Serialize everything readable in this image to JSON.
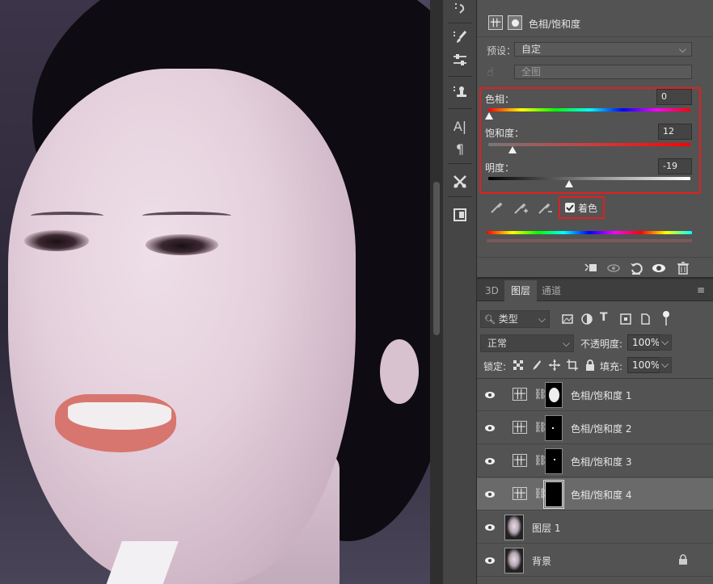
{
  "properties": {
    "title": "色相/饱和度",
    "preset_label": "预设：",
    "preset_value": "自定",
    "channel_value": "全图",
    "hue_label": "色相：",
    "hue_value": "0",
    "saturation_label": "饱和度：",
    "saturation_value": "12",
    "lightness_label": "明度：",
    "lightness_value": "-19",
    "colorize_label": "着色",
    "colorize_checked": true,
    "icons": [
      "adjust-layer-icon",
      "mask-icon",
      "hand-target-icon",
      "eyedropper-icon",
      "eyedropper-plus-icon",
      "eyedropper-minus-icon",
      "clip-layer-icon",
      "view-previous-icon",
      "reset-icon",
      "visibility-icon",
      "trash-icon"
    ]
  },
  "layers_panel": {
    "tabs": [
      "3D",
      "图层",
      "通道"
    ],
    "active_tab": "图层",
    "filter_label": "类型",
    "blend_mode": "正常",
    "opacity_label": "不透明度:",
    "opacity_value": "100%",
    "lock_label": "锁定:",
    "fill_label": "填充:",
    "fill_value": "100%",
    "layers": [
      {
        "name": "色相/饱和度 1"
      },
      {
        "name": "色相/饱和度 2"
      },
      {
        "name": "色相/饱和度 3"
      },
      {
        "name": "色相/饱和度 4"
      },
      {
        "name": "图层 1"
      },
      {
        "name": "背景"
      }
    ],
    "selected_layer": "色相/饱和度 4"
  },
  "toolstrip": {
    "icons": [
      "history-icon",
      "brush-icon",
      "adjustments-icon",
      "stamp-icon",
      "character-icon",
      "paragraph-icon",
      "tools-icon",
      "navigator-icon"
    ]
  }
}
